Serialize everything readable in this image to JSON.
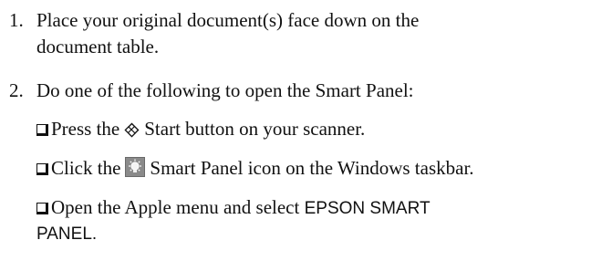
{
  "steps": [
    {
      "number": "1.",
      "lines": [
        "Place your original document(s) face down on the",
        "document table."
      ]
    },
    {
      "number": "2.",
      "text": "Do one of the following to open the Smart Panel:"
    }
  ],
  "options": [
    {
      "before": "Press the",
      "icon": "start-button-icon",
      "after": "Start button on your scanner."
    },
    {
      "before": "Click the",
      "icon": "smart-panel-icon",
      "after": "Smart Panel icon on the Windows taskbar."
    },
    {
      "before": "Open the Apple menu and select",
      "menu_item_line1": "EPSON SMART",
      "menu_item_line2": "PANEL",
      "after": "."
    }
  ]
}
